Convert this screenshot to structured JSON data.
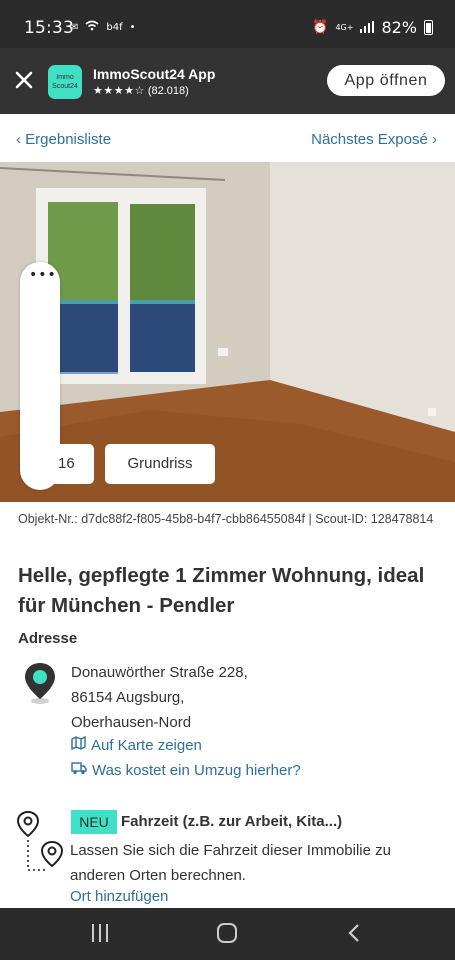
{
  "status_bar": {
    "time": "15:33",
    "left_icons": [
      "sim-icon",
      "wifi-icon",
      "b4f",
      "dot"
    ],
    "network": "4G+",
    "battery": "82%"
  },
  "app_banner": {
    "logo_text": "Immo Scout24",
    "app_name": "ImmoScout24 App",
    "stars": "★★★★☆",
    "rating_count": "(82.018)",
    "open_button": "App öffnen"
  },
  "nav": {
    "back_label": "‹ Ergebnisliste",
    "next_label": "Nächstes Exposé ›"
  },
  "gallery": {
    "photo_count": "16",
    "floorplan_button": "Grundriss"
  },
  "listing": {
    "object_ids": "Objekt-Nr.: d7dc88f2-f805-45b8-b4f7-cbb86455084f | Scout-ID: 128478814",
    "title": "Helle, gepflegte 1 Zimmer Wohnung, ideal für München - Pendler"
  },
  "address": {
    "heading": "Adresse",
    "street": "Donauwörther Straße 228,",
    "city": "86154 Augsburg,",
    "district": "Oberhausen-Nord",
    "map_link": "Auf Karte zeigen",
    "move_link": "Was kostet ein Umzug hierher?"
  },
  "travel": {
    "badge": "NEU",
    "heading": "Fahrzeit (z.B. zur Arbeit, Kita...)",
    "text": "Lassen Sie sich die Fahrzeit dieser Immobilie zu anderen Orten berechnen.",
    "add_link": "Ort hinzufügen"
  },
  "colors": {
    "accent": "#3fe0c5",
    "link": "#2e6f9e",
    "banner": "#333333"
  }
}
